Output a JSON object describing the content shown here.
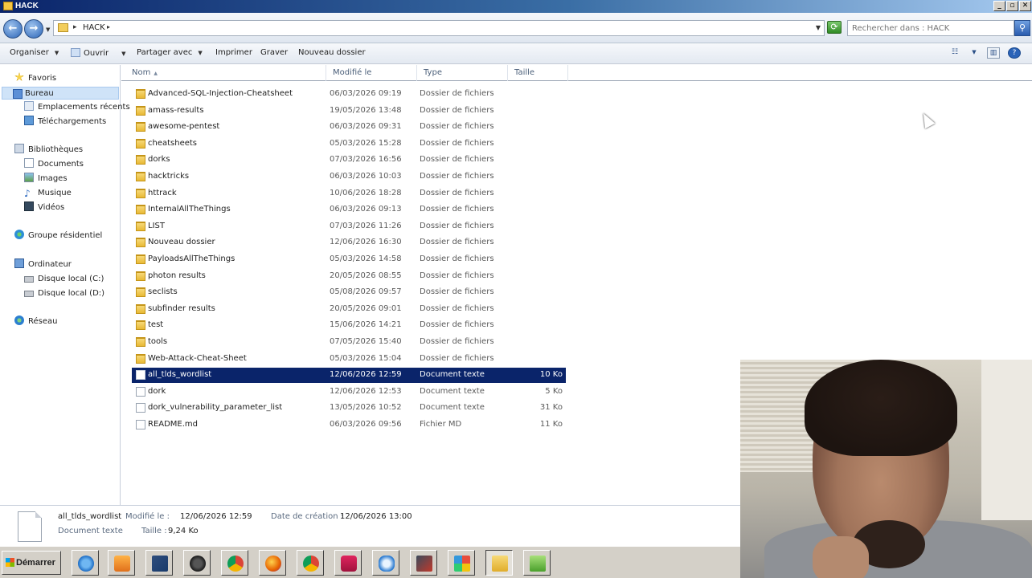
{
  "window": {
    "title": "HACK"
  },
  "address": {
    "crumb": "HACK",
    "search_placeholder": "Rechercher dans : HACK"
  },
  "toolbar": {
    "organize": "Organiser",
    "open": "Ouvrir",
    "share": "Partager avec",
    "print": "Imprimer",
    "burn": "Graver",
    "new_folder": "Nouveau dossier"
  },
  "sidebar": {
    "favorites": "Favoris",
    "desktop": "Bureau",
    "recent": "Emplacements récents",
    "downloads": "Téléchargements",
    "libraries": "Bibliothèques",
    "documents": "Documents",
    "images": "Images",
    "music": "Musique",
    "videos": "Vidéos",
    "homegroup": "Groupe résidentiel",
    "computer": "Ordinateur",
    "disk_c": "Disque local (C:)",
    "disk_d": "Disque local (D:)",
    "network": "Réseau"
  },
  "columns": {
    "name": "Nom",
    "modified": "Modifié le",
    "type": "Type",
    "size": "Taille"
  },
  "files": [
    {
      "name": "Advanced-SQL-Injection-Cheatsheet",
      "modified": "06/03/2026 09:19",
      "type": "Dossier de fichiers",
      "size": ""
    },
    {
      "name": "amass-results",
      "modified": "19/05/2026 13:48",
      "type": "Dossier de fichiers",
      "size": ""
    },
    {
      "name": "awesome-pentest",
      "modified": "06/03/2026 09:31",
      "type": "Dossier de fichiers",
      "size": ""
    },
    {
      "name": "cheatsheets",
      "modified": "05/03/2026 15:28",
      "type": "Dossier de fichiers",
      "size": ""
    },
    {
      "name": "dorks",
      "modified": "07/03/2026 16:56",
      "type": "Dossier de fichiers",
      "size": ""
    },
    {
      "name": "hacktricks",
      "modified": "06/03/2026 10:03",
      "type": "Dossier de fichiers",
      "size": ""
    },
    {
      "name": "httrack",
      "modified": "10/06/2026 18:28",
      "type": "Dossier de fichiers",
      "size": ""
    },
    {
      "name": "InternalAllTheThings",
      "modified": "06/03/2026 09:13",
      "type": "Dossier de fichiers",
      "size": ""
    },
    {
      "name": "LIST",
      "modified": "07/03/2026 11:26",
      "type": "Dossier de fichiers",
      "size": ""
    },
    {
      "name": "Nouveau dossier",
      "modified": "12/06/2026 16:30",
      "type": "Dossier de fichiers",
      "size": ""
    },
    {
      "name": "PayloadsAllTheThings",
      "modified": "05/03/2026 14:58",
      "type": "Dossier de fichiers",
      "size": ""
    },
    {
      "name": "photon results",
      "modified": "20/05/2026 08:55",
      "type": "Dossier de fichiers",
      "size": ""
    },
    {
      "name": "seclists",
      "modified": "05/08/2026 09:57",
      "type": "Dossier de fichiers",
      "size": ""
    },
    {
      "name": "subfinder results",
      "modified": "20/05/2026 09:01",
      "type": "Dossier de fichiers",
      "size": ""
    },
    {
      "name": "test",
      "modified": "15/06/2026 14:21",
      "type": "Dossier de fichiers",
      "size": ""
    },
    {
      "name": "tools",
      "modified": "07/05/2026 15:40",
      "type": "Dossier de fichiers",
      "size": ""
    },
    {
      "name": "Web-Attack-Cheat-Sheet",
      "modified": "05/03/2026 15:04",
      "type": "Dossier de fichiers",
      "size": ""
    },
    {
      "name": "all_tlds_wordlist",
      "modified": "12/06/2026 12:59",
      "type": "Document texte",
      "size": "10 Ko"
    },
    {
      "name": "dork",
      "modified": "12/06/2026 12:53",
      "type": "Document texte",
      "size": "5 Ko"
    },
    {
      "name": "dork_vulnerability_parameter_list",
      "modified": "13/05/2026 10:52",
      "type": "Document texte",
      "size": "31 Ko"
    },
    {
      "name": "README.md",
      "modified": "06/03/2026 09:56",
      "type": "Fichier MD",
      "size": "11 Ko"
    }
  ],
  "details": {
    "filename": "all_tlds_wordlist",
    "modified_label": "Modifié le :",
    "modified_value": "12/06/2026 12:59",
    "created_label": "Date de création :",
    "created_value": "12/06/2026 13:00",
    "filetype": "Document texte",
    "size_label": "Taille :",
    "size_value": "9,24 Ko"
  },
  "taskbar": {
    "start": "Démarrer"
  },
  "colors": {
    "selection": "#0a246a",
    "titlebar_start": "#0a246a",
    "folder": "#e8b935"
  }
}
